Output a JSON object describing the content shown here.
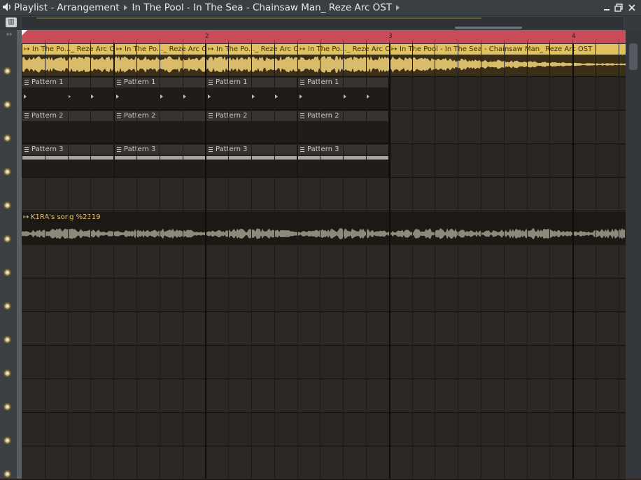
{
  "window": {
    "breadcrumbs": [
      "Playlist - Arrangement",
      "In The Pool - In The Sea - Chainsaw Man_ Reze Arc OST"
    ],
    "minimize_icon": "minimize-icon",
    "restore_icon": "restore-icon",
    "close_icon": "close-icon"
  },
  "timeline": {
    "bar_numbers": [
      "2",
      "3",
      "4"
    ]
  },
  "tracks": {
    "track1_clips": [
      "In The Po..._ Reze Arc OST",
      "In The Po..._ Reze Arc OST",
      "In The Po..._ Reze Arc OST",
      "In The Po..._ Reze Arc OST",
      "In The Pool - In The Sea - Chainsaw Man_ Reze Arc OST"
    ],
    "pattern1_label": "Pattern 1",
    "pattern2_label": "Pattern 2",
    "pattern3_label": "Pattern 3",
    "k1ra_label": "K1RA's song %2319"
  },
  "colors": {
    "audio_clip": "#e2c25f",
    "timeline": "#c84c59",
    "pattern_header": "#38332f"
  }
}
